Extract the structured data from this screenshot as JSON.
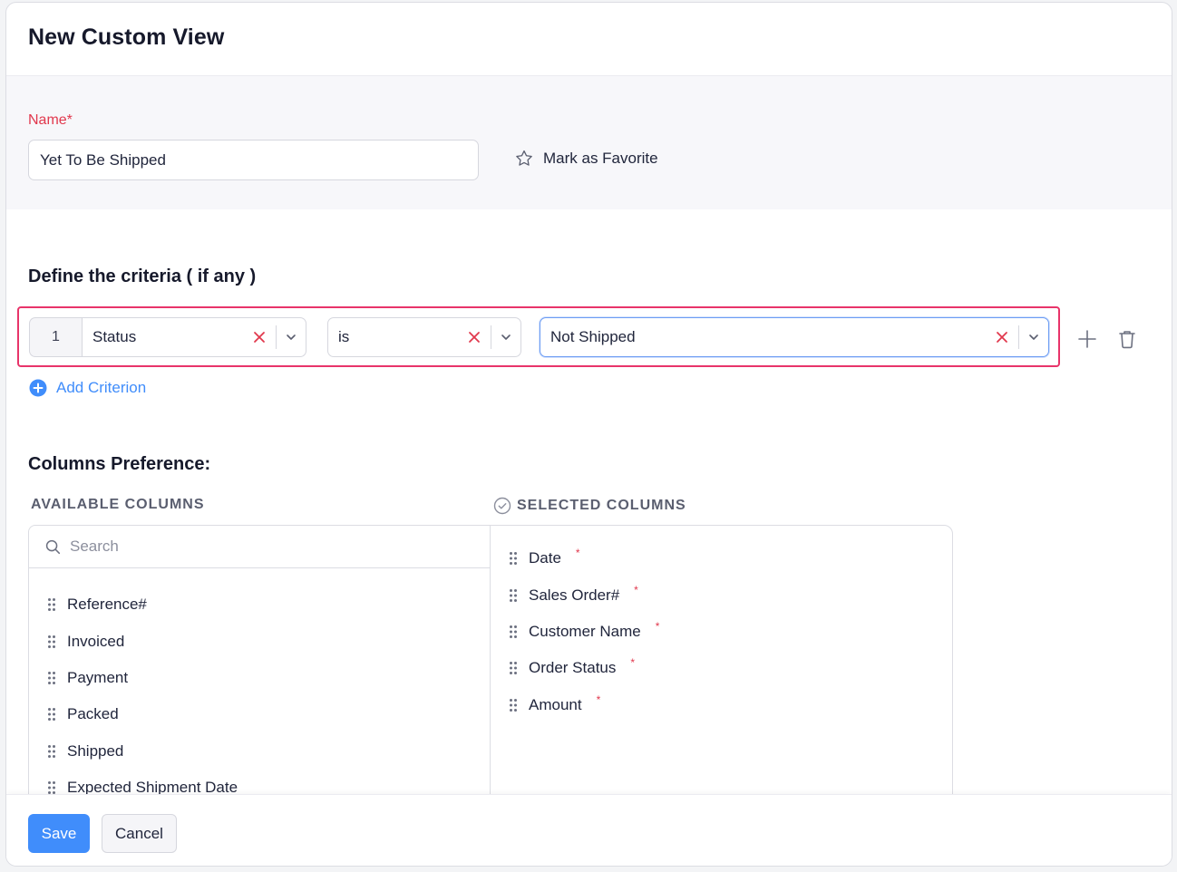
{
  "header": {
    "title": "New Custom View"
  },
  "name_section": {
    "label": "Name*",
    "value": "Yet To Be Shipped",
    "favorite_label": "Mark as Favorite",
    "favorite_icon": "star-outline-icon"
  },
  "criteria": {
    "title": "Define the criteria ( if any )",
    "rows": [
      {
        "index": "1",
        "field": "Status",
        "comparator": "is",
        "value": "Not Shipped"
      }
    ],
    "add_label": "Add Criterion",
    "highlight_color": "#e8346a"
  },
  "columns": {
    "title": "Columns Preference:",
    "available_label": "AVAILABLE COLUMNS",
    "selected_label": "SELECTED COLUMNS",
    "search_placeholder": "Search",
    "available": [
      "Reference#",
      "Invoiced",
      "Payment",
      "Packed",
      "Shipped",
      "Expected Shipment Date"
    ],
    "selected": [
      "Date",
      "Sales Order#",
      "Customer Name",
      "Order Status",
      "Amount"
    ],
    "required_marker": "*"
  },
  "footer": {
    "save_label": "Save",
    "cancel_label": "Cancel"
  },
  "colors": {
    "accent": "#408dfb",
    "required": "#e1384d",
    "focus_border": "#6c9cf3"
  }
}
